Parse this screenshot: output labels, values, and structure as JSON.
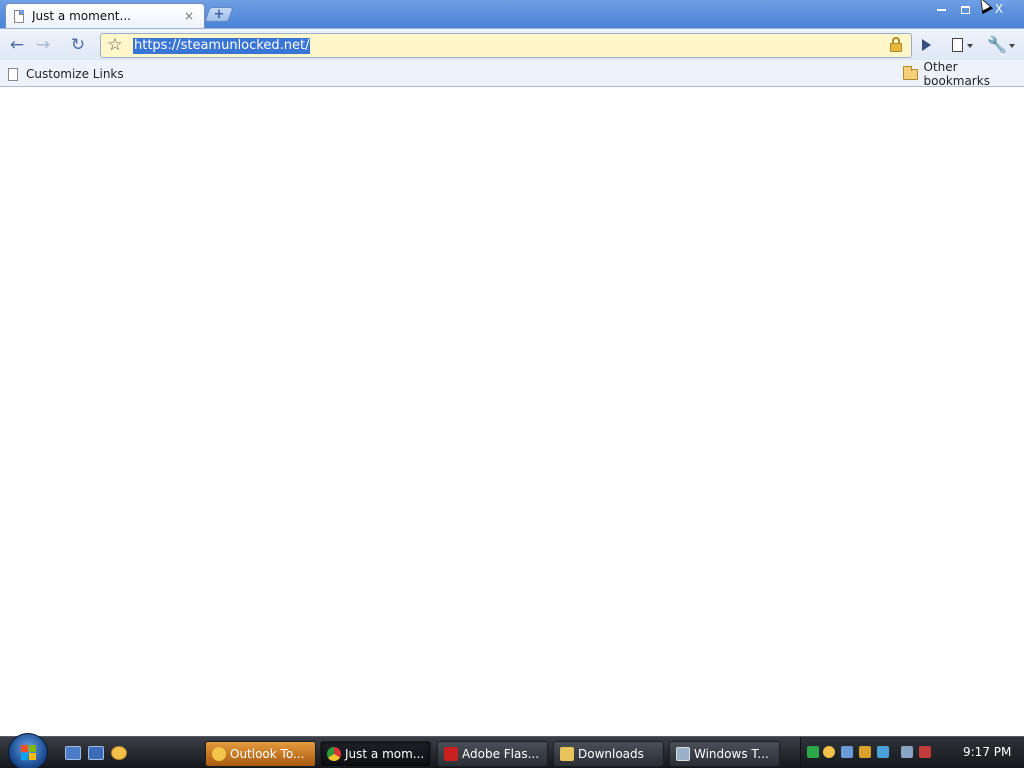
{
  "browser": {
    "tab": {
      "title": "Just a moment...",
      "close_glyph": "×"
    },
    "new_tab_glyph": "+",
    "window_controls": {
      "close_glyph": "X"
    },
    "toolbar": {
      "back_glyph": "←",
      "forward_glyph": "→",
      "reload_glyph": "↻",
      "star_glyph": "☆",
      "url": "https://steamunlocked.net/"
    },
    "bookmarks": {
      "left_label": "Customize Links",
      "right_label": "Other bookmarks"
    }
  },
  "taskbar": {
    "quick_launch": [
      "show-desktop-icon",
      "switch-windows-icon",
      "outlook-icon"
    ],
    "tasks": [
      {
        "label": "Outlook To...",
        "icon": "outlook-icon"
      },
      {
        "label": "Just a mom...",
        "icon": "chrome-icon"
      },
      {
        "label": "Adobe Flas...",
        "icon": "flash-icon"
      },
      {
        "label": "Downloads",
        "icon": "folder-icon"
      },
      {
        "label": "Windows T...",
        "icon": "windows-task-icon"
      }
    ],
    "clock": "9:17 PM"
  },
  "colors": {
    "title_bar": "#4a82d6",
    "url_selection": "#3875d7",
    "omnibox_bg": "#fff7c9",
    "taskbar": "#14171b"
  }
}
